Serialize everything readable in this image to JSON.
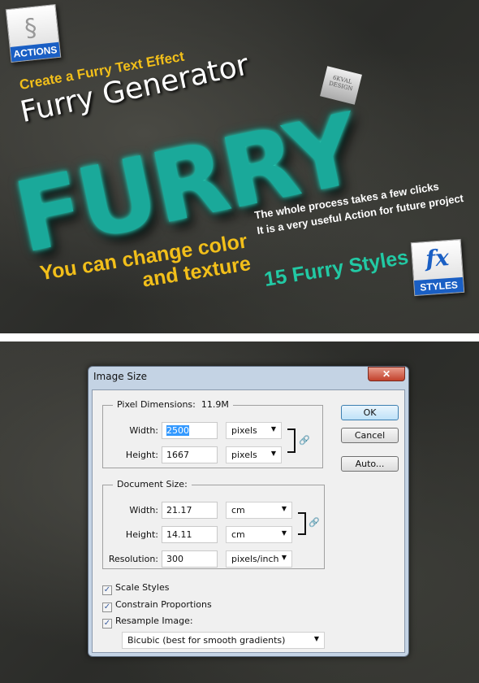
{
  "banner": {
    "actions_label": "ACTIONS",
    "subtitle": "Create a Furry Text Effect",
    "title": "Furry Generator",
    "fur_text": "FURRY",
    "tag_text": "6KVAL DESIGN",
    "color_line1": "You can change color",
    "color_line2": "and texture",
    "process_line1": "The whole process takes a few clicks",
    "process_line2": "It is a very useful Action for future project",
    "styles_count": "15 Furry Styles",
    "fx_label": "fx",
    "styles_label": "STYLES",
    "colors": {
      "fur": "#1aa99a",
      "yellow": "#f2bf1a",
      "teal_text": "#22c9a4",
      "badge_blue": "#1a5fc4"
    }
  },
  "dialog": {
    "title": "Image Size",
    "close_icon": "close-icon",
    "pixel_dimensions": {
      "label": "Pixel Dimensions:",
      "size": "11.9M",
      "width_label": "Width:",
      "width_value": "2500",
      "width_unit": "pixels",
      "height_label": "Height:",
      "height_value": "1667",
      "height_unit": "pixels"
    },
    "document_size": {
      "label": "Document Size:",
      "width_label": "Width:",
      "width_value": "21.17",
      "width_unit": "cm",
      "height_label": "Height:",
      "height_value": "14.11",
      "height_unit": "cm",
      "resolution_label": "Resolution:",
      "resolution_value": "300",
      "resolution_unit": "pixels/inch"
    },
    "buttons": {
      "ok": "OK",
      "cancel": "Cancel",
      "auto": "Auto..."
    },
    "checkboxes": [
      {
        "label": "Scale Styles",
        "checked": true
      },
      {
        "label": "Constrain Proportions",
        "checked": true
      },
      {
        "label": "Resample Image:",
        "checked": true
      }
    ],
    "resample_method": "Bicubic (best for smooth gradients)"
  }
}
